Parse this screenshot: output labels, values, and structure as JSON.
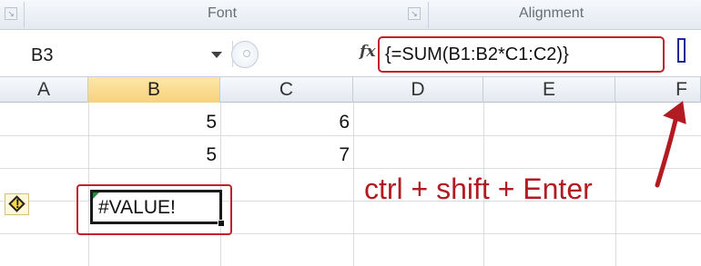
{
  "ribbon": {
    "font_group_label": "Font",
    "alignment_group_label": "Alignment"
  },
  "formula_bar": {
    "name_box_value": "B3",
    "fx_label": "fx",
    "formula": "{=SUM(B1:B2*C1:C2)}"
  },
  "columns": [
    "A",
    "B",
    "C",
    "D",
    "E",
    "F"
  ],
  "active_column": "B",
  "cells": {
    "B1": "5",
    "C1": "6",
    "B2": "5",
    "C2": "7",
    "B3": "#VALUE!"
  },
  "annotation": {
    "text": "ctrl + shift + Enter",
    "color": "#b31b22"
  },
  "colors": {
    "highlight_border": "#c0212a",
    "expand_marker": "#1e2a8f",
    "active_header": "#f7d27c"
  }
}
